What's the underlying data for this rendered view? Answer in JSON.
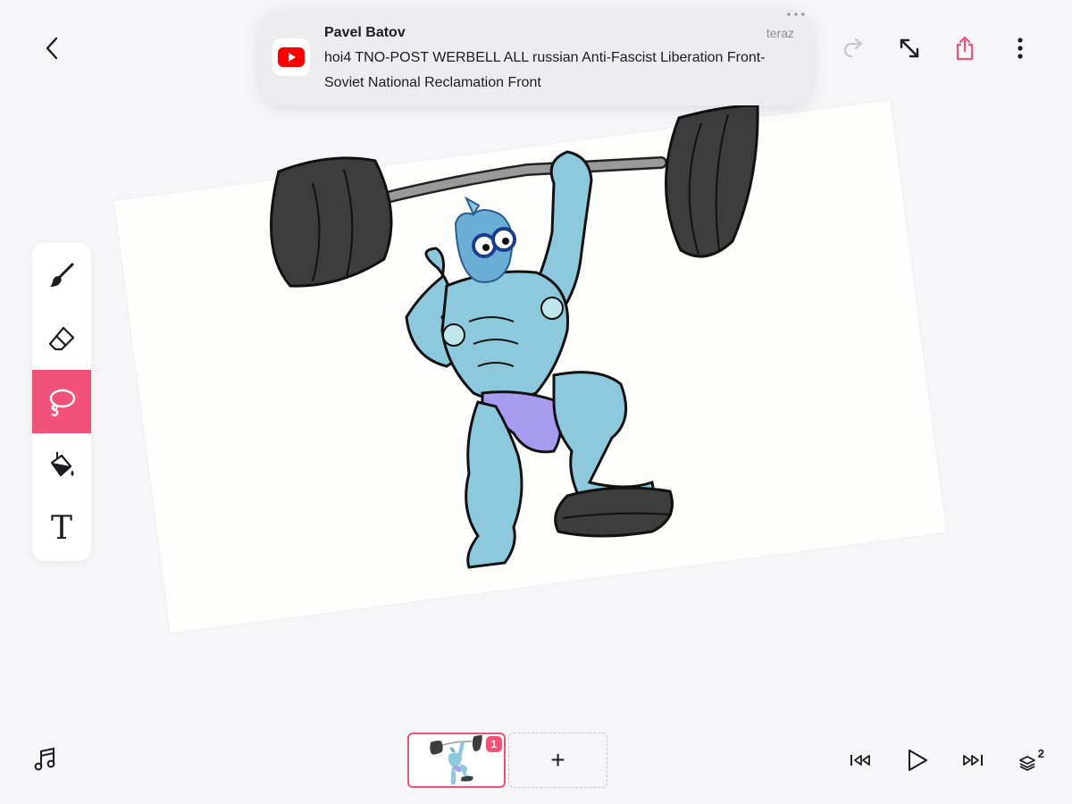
{
  "notification": {
    "sender": "Pavel Batov",
    "time": "teraz",
    "message": "hoi4 TNO-POST WERBELL ALL russian Anti-Fascist Liberation Front-Soviet National Reclamation Front",
    "app_icon": "youtube-icon"
  },
  "toolbar": {
    "back_icon": "chevron-left-icon",
    "redo_icon": "redo-icon",
    "fullscreen_icon": "expand-icon",
    "share_icon": "share-icon",
    "more_icon": "more-vertical-icon"
  },
  "tools": [
    {
      "name": "brush",
      "icon": "brush-icon",
      "active": false
    },
    {
      "name": "eraser",
      "icon": "eraser-icon",
      "active": false
    },
    {
      "name": "lasso",
      "icon": "lasso-icon",
      "active": true
    },
    {
      "name": "fill",
      "icon": "paint-bucket-icon",
      "active": false
    },
    {
      "name": "text",
      "icon": "text-icon",
      "label": "T",
      "active": false
    }
  ],
  "frames": {
    "current_badge": "1",
    "add_label": "+"
  },
  "playback": {
    "layers_count": "2"
  },
  "colors": {
    "accent": "#f2527a",
    "background": "#f6f6f8",
    "skin": "#8cc9dc",
    "shorts": "#a89cf0",
    "weights": "#3d3d3d"
  }
}
